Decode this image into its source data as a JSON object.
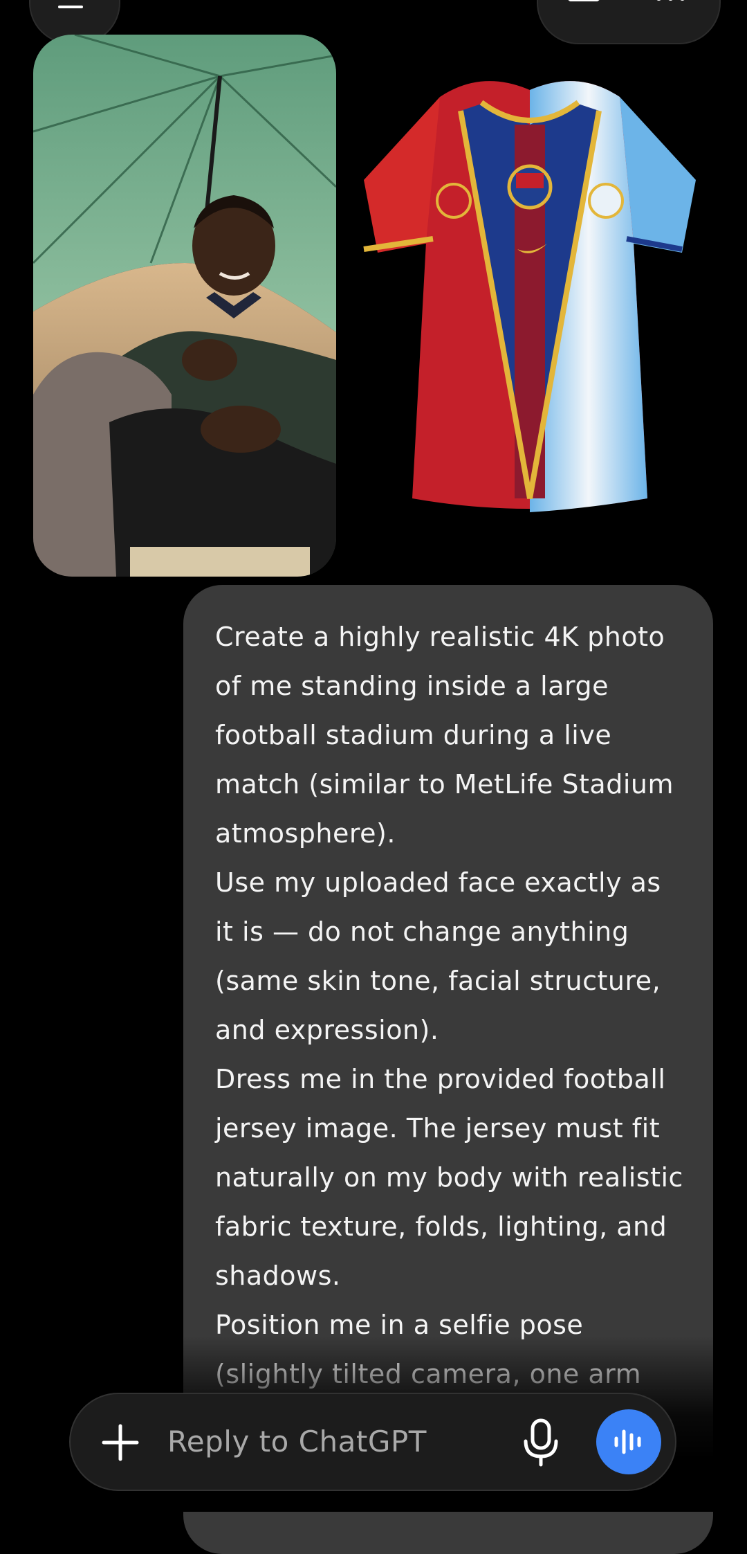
{
  "composer": {
    "placeholder": "Reply to ChatGPT"
  },
  "message": {
    "text": "Create a highly realistic 4K photo\nof me standing inside a large\nfootball stadium during a live\nmatch (similar to MetLife Stadium\natmosphere).\nUse my uploaded face exactly as\nit is — do not change anything\n(same skin tone, facial structure,\nand expression).\nDress me in the provided football\njersey image. The jersey must fit\nnaturally on my body with realistic\nfabric texture, folds, lighting, and\nshadows.\nPosition me in a selfie pose\n(slightly tilted camera, one arm"
  },
  "icons": {
    "menu": "menu-icon",
    "edit": "edit-icon",
    "more": "more-icon",
    "plus": "plus-icon",
    "mic": "mic-icon",
    "voice": "voice-mode-icon"
  },
  "colors": {
    "background": "#000000",
    "bubble": "#3a3a3a",
    "composer": "#1c1c1c",
    "voice_button": "#3b82f6"
  }
}
